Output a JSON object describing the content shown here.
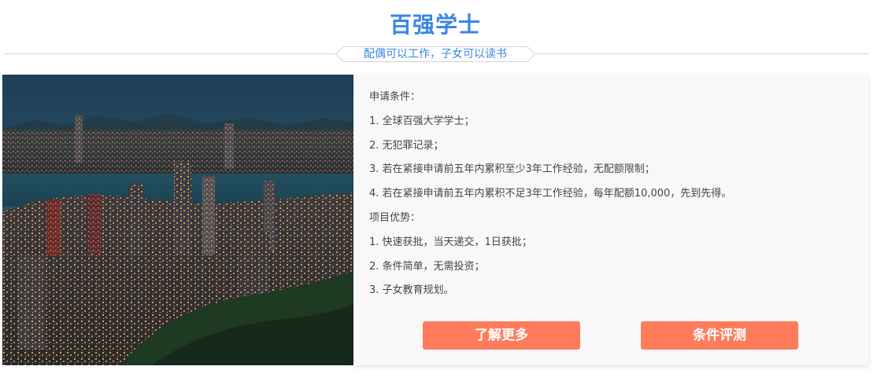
{
  "header": {
    "title": "百强学士",
    "subtitle": "配偶可以工作，子女可以读书"
  },
  "content": {
    "lines": [
      "申请条件：",
      "1. 全球百强大学学士；",
      "2. 无犯罪记录；",
      "3. 若在紧接申请前五年内累积至少3年工作经验，无配额限制；",
      "4. 若在紧接申请前五年内累积不足3年工作经验，每年配额10,000，先到先得。",
      "项目优势：",
      "1. 快速获批，当天递交，1日获批；",
      "2. 条件简单，无需投资；",
      "3. 子女教育规划。"
    ]
  },
  "buttons": {
    "learn_more": "了解更多",
    "assessment": "条件评测"
  },
  "colors": {
    "accent_blue": "#3a86e4",
    "button_orange": "#fe7c5c",
    "panel_bg": "#f8f8f8"
  }
}
